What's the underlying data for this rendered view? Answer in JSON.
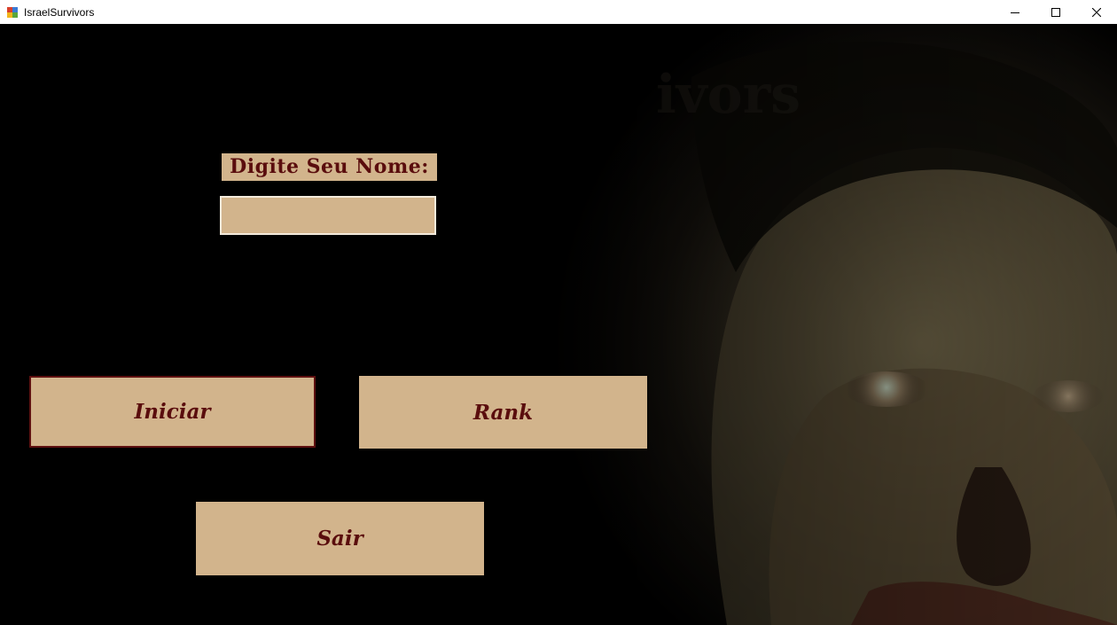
{
  "window": {
    "title": "IsraelSurvivors",
    "icon": "app-icon",
    "controls": [
      "minimize-icon",
      "maximize-icon",
      "close-icon"
    ]
  },
  "form": {
    "name_label": "Digite Seu Nome:",
    "name_value": "",
    "name_placeholder": ""
  },
  "buttons": {
    "start": "Iniciar",
    "rank": "Rank",
    "exit": "Sair"
  },
  "colors": {
    "button_bg": "#d2b48c",
    "button_text": "#5a0d0d",
    "background": "#000000"
  }
}
